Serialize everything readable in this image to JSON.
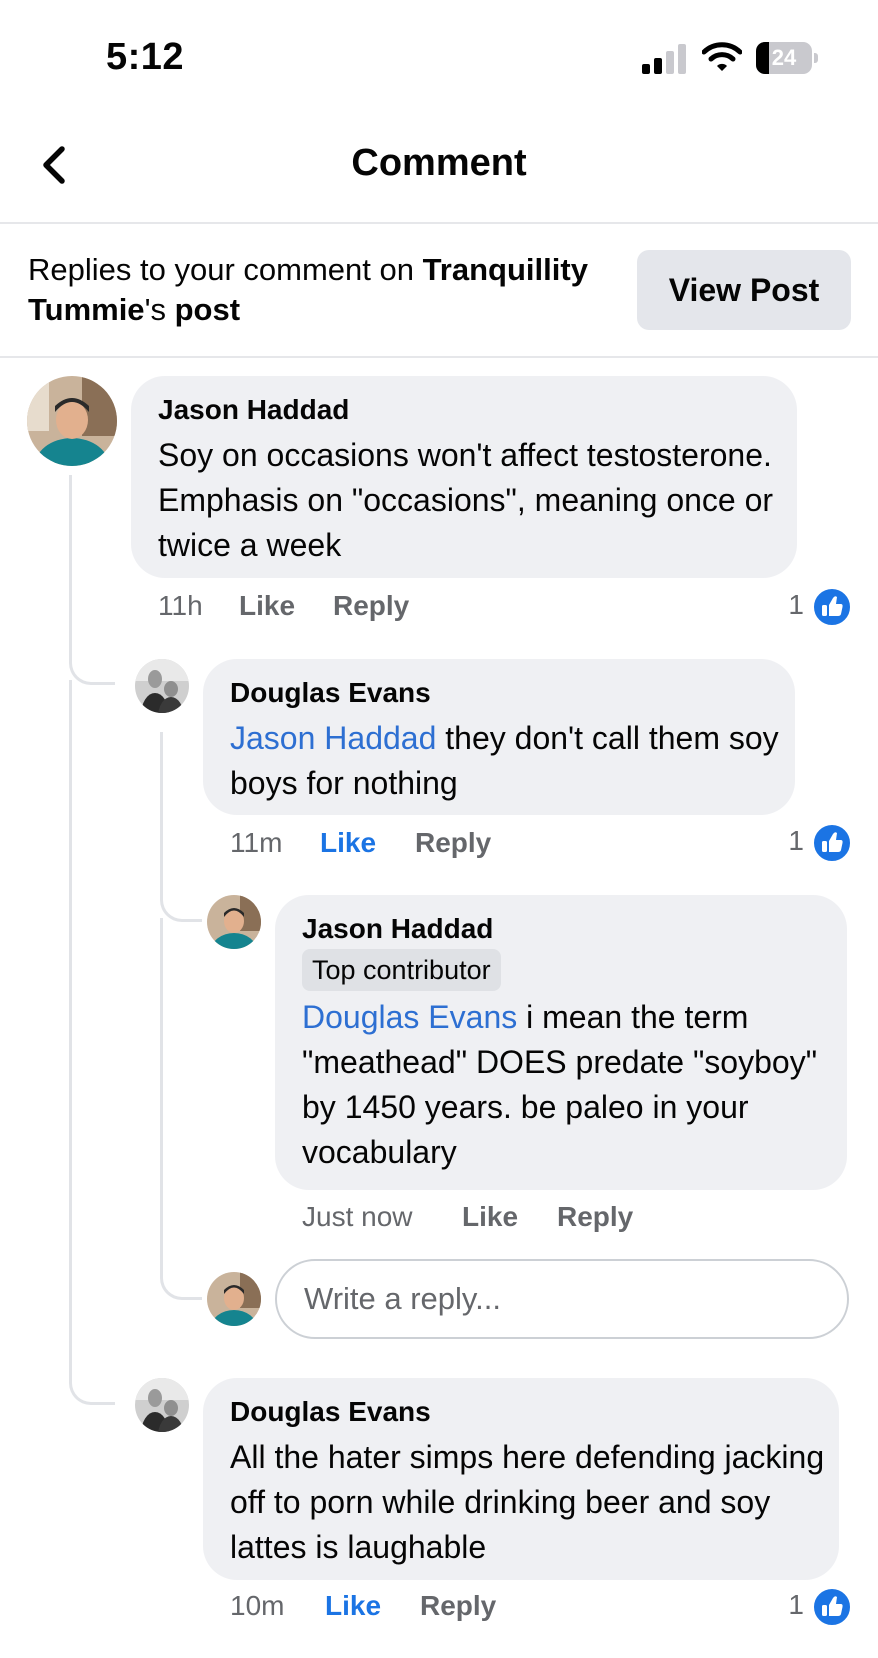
{
  "status_bar": {
    "time": "5:12",
    "battery": "24",
    "battery_level": 0.24
  },
  "header": {
    "title": "Comment"
  },
  "banner": {
    "prefix": "Replies to your comment on ",
    "page_name": "Tranquillity Tummie",
    "possessive": "'s ",
    "post_word": "post",
    "button": "View Post"
  },
  "comments": [
    {
      "author": "Jason Haddad",
      "text": "Soy on occasions won't affect testosterone. Emphasis on \"occasions\", meaning once or twice a week",
      "time": "11h",
      "like": "Like",
      "reply": "Reply",
      "reactions": "1"
    },
    {
      "author": "Douglas Evans",
      "mention": "Jason Haddad",
      "text": " they don't call them soy boys for nothing",
      "time": "11m",
      "like": "Like",
      "reply": "Reply",
      "reactions": "1"
    },
    {
      "author": "Jason Haddad",
      "badge": "Top contributor",
      "mention": "Douglas Evans",
      "text": " i mean the term \"meathead\" DOES predate \"soyboy\" by 1450 years. be paleo in your vocabulary",
      "time": "Just now",
      "like": "Like",
      "reply": "Reply"
    },
    {
      "author": "Douglas Evans",
      "text": "All the hater simps here defending jacking off to porn while drinking beer and soy lattes is laughable",
      "time": "10m",
      "like": "Like",
      "reply": "Reply",
      "reactions": "1"
    }
  ],
  "reply_box": {
    "placeholder": "Write a reply..."
  },
  "icons": {
    "back": "chevron-left-icon",
    "like_reaction": "thumbs-up-icon",
    "signal": "cellular-signal-icon",
    "wifi": "wifi-icon",
    "battery": "battery-icon"
  },
  "colors": {
    "mention": "#2d6fd2",
    "liked": "#1b74e4",
    "bubble": "#eff0f3",
    "like_badge": "#1b74e4"
  }
}
